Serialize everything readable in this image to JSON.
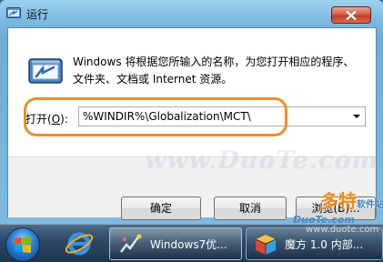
{
  "window": {
    "title": "运行",
    "description_line1": "Windows 将根据您所输入的名称，为您打开相应的程序、",
    "description_line2": "文件夹、文档或 Internet 资源。",
    "open_label": "打开",
    "open_label_accel": "O",
    "open_value": "%WINDIR%\\Globalization\\MCT\\",
    "buttons": {
      "ok": "确定",
      "cancel": "取消",
      "browse": "浏览(B)..."
    }
  },
  "watermark": {
    "middle": "www.DuoTe.com",
    "brand": "多特",
    "brand_suffix": "软件站",
    "site": "DuoTe.com",
    "url": "www.duote.com"
  },
  "taskbar": {
    "run_task_label": "Windows7优...",
    "mofang_task_label": "魔方 1.0 内部..."
  },
  "colors": {
    "highlight_ring": "#ef8e2a",
    "close_button": "#c23b20",
    "brand": "#f48a16"
  },
  "icons": {
    "title": "run-icon",
    "dialog": "run-program-icon",
    "close": "close-icon",
    "start": "windows-logo-icon",
    "ie": "internet-explorer-icon",
    "run_task": "run-app-icon",
    "mofang": "cube-icon"
  }
}
